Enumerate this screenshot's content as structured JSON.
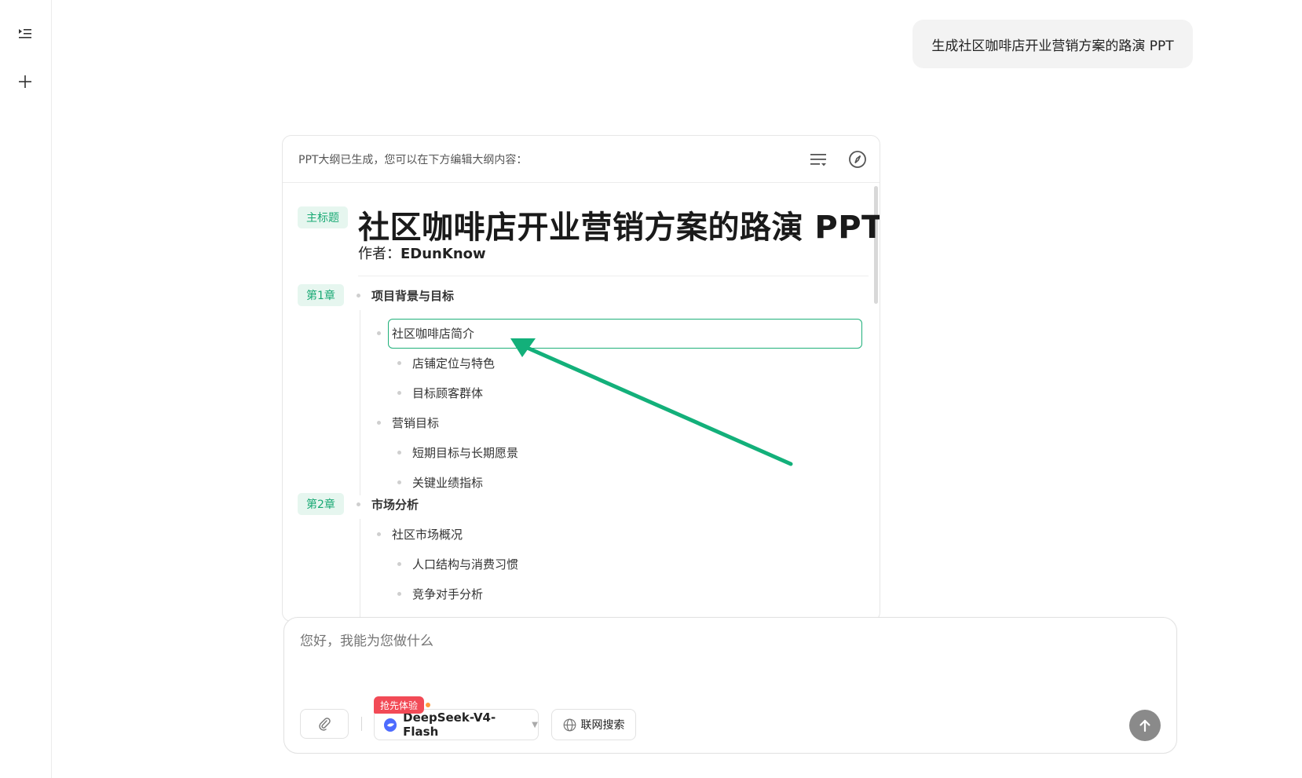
{
  "sidebar": {
    "toggle_icon": "sidebar-list-icon",
    "new_icon": "plus-icon"
  },
  "chat": {
    "user_message": "生成社区咖啡店开业营销方案的路演 PPT"
  },
  "outline_card": {
    "header_text": "PPT大纲已生成，您可以在下方编辑大纲内容：",
    "header_icons": [
      "filter-list-icon",
      "compass-icon"
    ],
    "title_tag": "主标题",
    "title": "社区咖啡店开业营销方案的路演 PPT",
    "author_label": "作者：",
    "author_name": "EDunKnow",
    "chapters": [
      {
        "tag": "第1章",
        "title": "项目背景与目标",
        "sections": [
          {
            "title": "社区咖啡店简介",
            "items": [
              "店铺定位与特色",
              "目标顾客群体"
            ]
          },
          {
            "title": "营销目标",
            "items": [
              "短期目标与长期愿景",
              "关键业绩指标"
            ]
          }
        ]
      },
      {
        "tag": "第2章",
        "title": "市场分析",
        "sections": [
          {
            "title": "社区市场概况",
            "items": [
              "人口结构与消费习惯",
              "竞争对手分析"
            ]
          }
        ]
      }
    ],
    "annotation_arrow_color": "#13b07a"
  },
  "composer": {
    "placeholder": "您好，我能为您做什么",
    "badge": "抢先体验",
    "model": "DeepSeek-V4-Flash",
    "web_search": "联网搜索",
    "attach_icon": "paperclip-icon",
    "send_icon": "arrow-up-icon",
    "globe_icon": "globe-icon"
  },
  "colors": {
    "accent_green": "#19a974",
    "tag_bg": "#e6f6ef",
    "badge_red": "#f24a56",
    "model_blue": "#4d6bfe"
  }
}
